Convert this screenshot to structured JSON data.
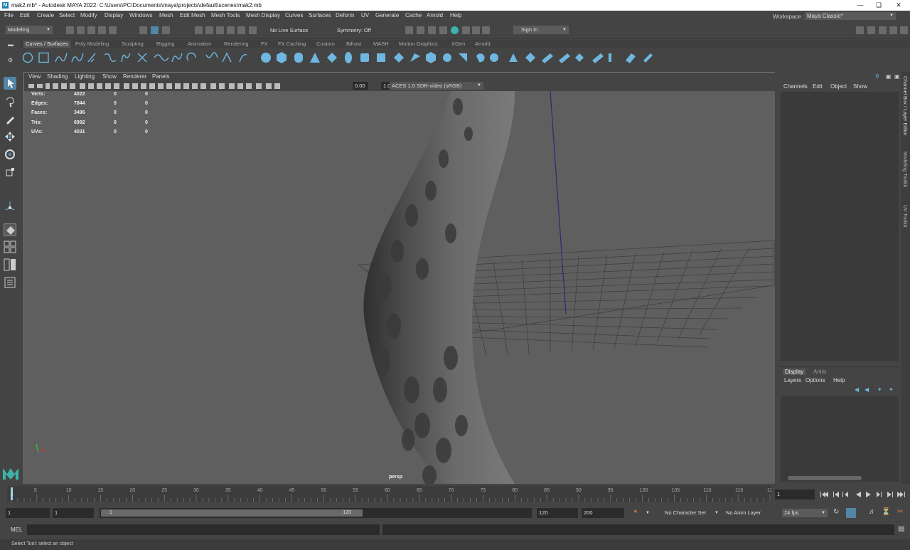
{
  "window": {
    "title": "mak2.mb* - Autodesk MAYA 2022: C:\\Users\\PC\\Documents\\maya\\projects\\default\\scenes\\mak2.mb",
    "app_icon": "M"
  },
  "menubar": {
    "items": [
      "File",
      "Edit",
      "Create",
      "Select",
      "Modify",
      "Display",
      "Windows",
      "Mesh",
      "Edit Mesh",
      "Mesh Tools",
      "Mesh Display",
      "Curves",
      "Surfaces",
      "Deform",
      "UV",
      "Generate",
      "Cache",
      "Arnold",
      "Help"
    ],
    "workspace_label": "Workspace :",
    "workspace_value": "Maya Classic*"
  },
  "toolbar": {
    "mode": "Modeling",
    "live_surface": "No Live Surface",
    "symmetry": "Symmetry: Off",
    "sign_in": "Sign In"
  },
  "shelf": {
    "tabs": [
      "Curves / Surfaces",
      "Poly Modeling",
      "Sculpting",
      "Rigging",
      "Animation",
      "Rendering",
      "FX",
      "FX Caching",
      "Custom",
      "Bifrost",
      "MASH",
      "Motion Graphics",
      "XGen",
      "Arnold"
    ],
    "active_tab": "Curves / Surfaces"
  },
  "viewport": {
    "menu": [
      "View",
      "Shading",
      "Lighting",
      "Show",
      "Renderer",
      "Panels"
    ],
    "exposure": "0.00",
    "gamma": "1.00",
    "color_space": "ACES 1.0 SDR-video (sRGB)",
    "camera_label": "persp",
    "hud": [
      {
        "label": "Verts:",
        "v1": "4022",
        "v2": "0",
        "v3": "0"
      },
      {
        "label": "Edges:",
        "v1": "7844",
        "v2": "0",
        "v3": "0"
      },
      {
        "label": "Faces:",
        "v1": "3496",
        "v2": "0",
        "v3": "0"
      },
      {
        "label": "Tris:",
        "v1": "6992",
        "v2": "0",
        "v3": "0"
      },
      {
        "label": "UVs:",
        "v1": "4031",
        "v2": "0",
        "v3": "0"
      }
    ]
  },
  "channel_box": {
    "menu": [
      "Channels",
      "Edit",
      "Object",
      "Show"
    ]
  },
  "layer_editor": {
    "tabs": [
      "Display",
      "Anim"
    ],
    "menu": [
      "Layers",
      "Options",
      "Help"
    ]
  },
  "side_tabs": [
    "Channel Box / Layer Editor",
    "Modeling Toolkit",
    "UV Toolkit"
  ],
  "timeline": {
    "ticks": [
      "5",
      "10",
      "15",
      "20",
      "25",
      "30",
      "35",
      "40",
      "45",
      "50",
      "55",
      "60",
      "65",
      "70",
      "75",
      "80",
      "85",
      "90",
      "95",
      "100",
      "105",
      "110",
      "115",
      "120"
    ],
    "current_frame": "1",
    "playhead_label": "1"
  },
  "range": {
    "start": "1",
    "anim_start": "1",
    "slider_start": "1",
    "slider_end": "120",
    "anim_end": "120",
    "end": "200",
    "character_set": "No Character Set",
    "anim_layer": "No Anim Layer",
    "fps": "24 fps"
  },
  "command": {
    "lang": "MEL"
  },
  "help_line": "Select Tool: select an object",
  "colors": {
    "accent": "#5285a6",
    "bg": "#444444",
    "viewport": "#5f5f5f",
    "maya_logo": "#3fb3a9"
  }
}
